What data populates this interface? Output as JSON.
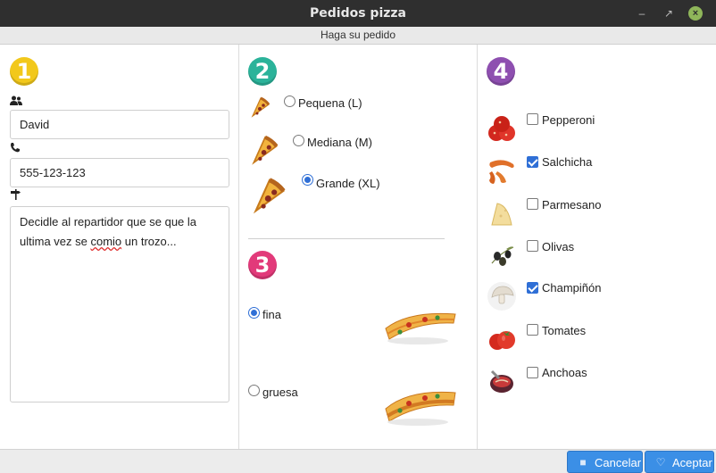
{
  "window": {
    "title": "Pedidos pizza",
    "subtitle": "Haga su pedido"
  },
  "steps": {
    "one": "1",
    "two": "2",
    "three": "3",
    "four": "4"
  },
  "customer": {
    "name": "David",
    "phone": "555-123-123",
    "notes_line1": "Decidle al repartidor que se que la",
    "notes_line2_pre": "ultima vez se ",
    "notes_line2_spell": "comio",
    "notes_line2_post": " un trozo..."
  },
  "sizes": [
    {
      "label": "Pequena (L)",
      "selected": false
    },
    {
      "label": "Mediana (M)",
      "selected": false
    },
    {
      "label": "Grande (XL)",
      "selected": true
    }
  ],
  "crusts": [
    {
      "label": "fina",
      "selected": true
    },
    {
      "label": "gruesa",
      "selected": false
    }
  ],
  "toppings": [
    {
      "label": "Pepperoni",
      "checked": false,
      "icon": "pepperoni-icon"
    },
    {
      "label": "Salchicha",
      "checked": true,
      "icon": "sausage-icon"
    },
    {
      "label": "Parmesano",
      "checked": false,
      "icon": "cheese-icon"
    },
    {
      "label": "Olivas",
      "checked": false,
      "icon": "olives-icon"
    },
    {
      "label": "Champiñón",
      "checked": true,
      "icon": "mushroom-icon"
    },
    {
      "label": "Tomates",
      "checked": false,
      "icon": "tomato-icon"
    },
    {
      "label": "Anchoas",
      "checked": false,
      "icon": "anchovy-icon"
    }
  ],
  "buttons": {
    "cancel": "Cancelar",
    "accept": "Aceptar"
  },
  "colors": {
    "step1": "#f2c81b",
    "step2": "#2bb39a",
    "step3": "#e23a7a",
    "step4": "#8e4fb0",
    "accent": "#3b8fe6"
  }
}
